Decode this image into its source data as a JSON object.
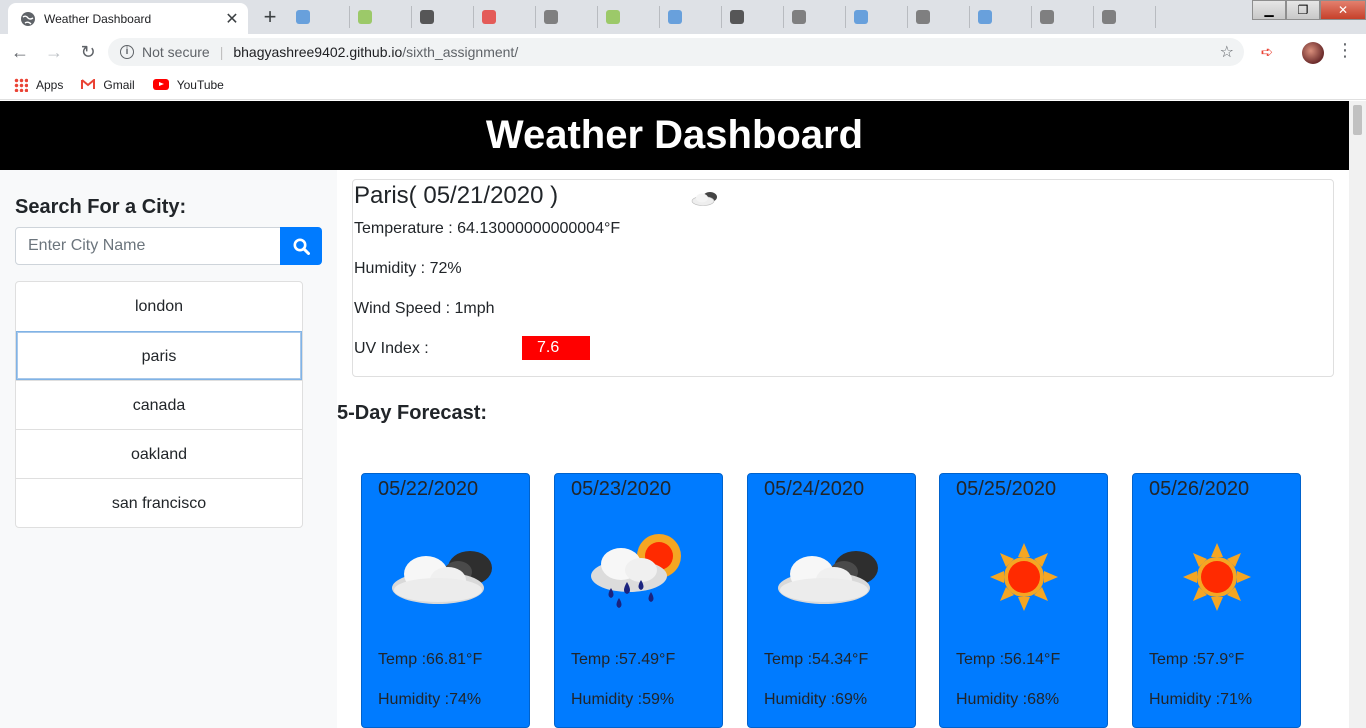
{
  "browser": {
    "tab_title": "Weather Dashboard",
    "tab_close": "✕",
    "new_tab": "+",
    "security": "Not secure",
    "url_domain": "bhagyashree9402.github.io",
    "url_path": "/sixth_assignment/",
    "bookmarks": {
      "apps": "Apps",
      "gmail": "Gmail",
      "youtube": "YouTube"
    }
  },
  "header": {
    "title": "Weather Dashboard"
  },
  "sidebar": {
    "search_title": "Search For a City:",
    "search_placeholder": "Enter City Name",
    "cities": [
      "london",
      "paris",
      "canada",
      "oakland",
      "san francisco"
    ],
    "active_city": "paris"
  },
  "current": {
    "title": "Paris( 05/21/2020 )",
    "temperature": "Temperature : 64.13000000000004°F",
    "humidity": "Humidity : 72%",
    "wind": "Wind Speed : 1mph",
    "uv_label": "UV Index :",
    "uv_value": "7.6",
    "uv_color": "#ff0000",
    "icon": "cloud-icon"
  },
  "forecast": {
    "title": "5-Day Forecast:",
    "days": [
      {
        "date": "05/22/2020",
        "icon": "broken-clouds-icon",
        "temp": "Temp :66.81°F",
        "humidity": "Humidity :74%"
      },
      {
        "date": "05/23/2020",
        "icon": "rain-sun-icon",
        "temp": "Temp :57.49°F",
        "humidity": "Humidity :59%"
      },
      {
        "date": "05/24/2020",
        "icon": "broken-clouds-icon",
        "temp": "Temp :54.34°F",
        "humidity": "Humidity :69%"
      },
      {
        "date": "05/25/2020",
        "icon": "sun-icon",
        "temp": "Temp :56.14°F",
        "humidity": "Humidity :68%"
      },
      {
        "date": "05/26/2020",
        "icon": "sun-icon",
        "temp": "Temp :57.9°F",
        "humidity": "Humidity :71%"
      }
    ]
  },
  "colors": {
    "header_bg": "#000000",
    "accent": "#007bff",
    "uv": "#ff0000"
  }
}
